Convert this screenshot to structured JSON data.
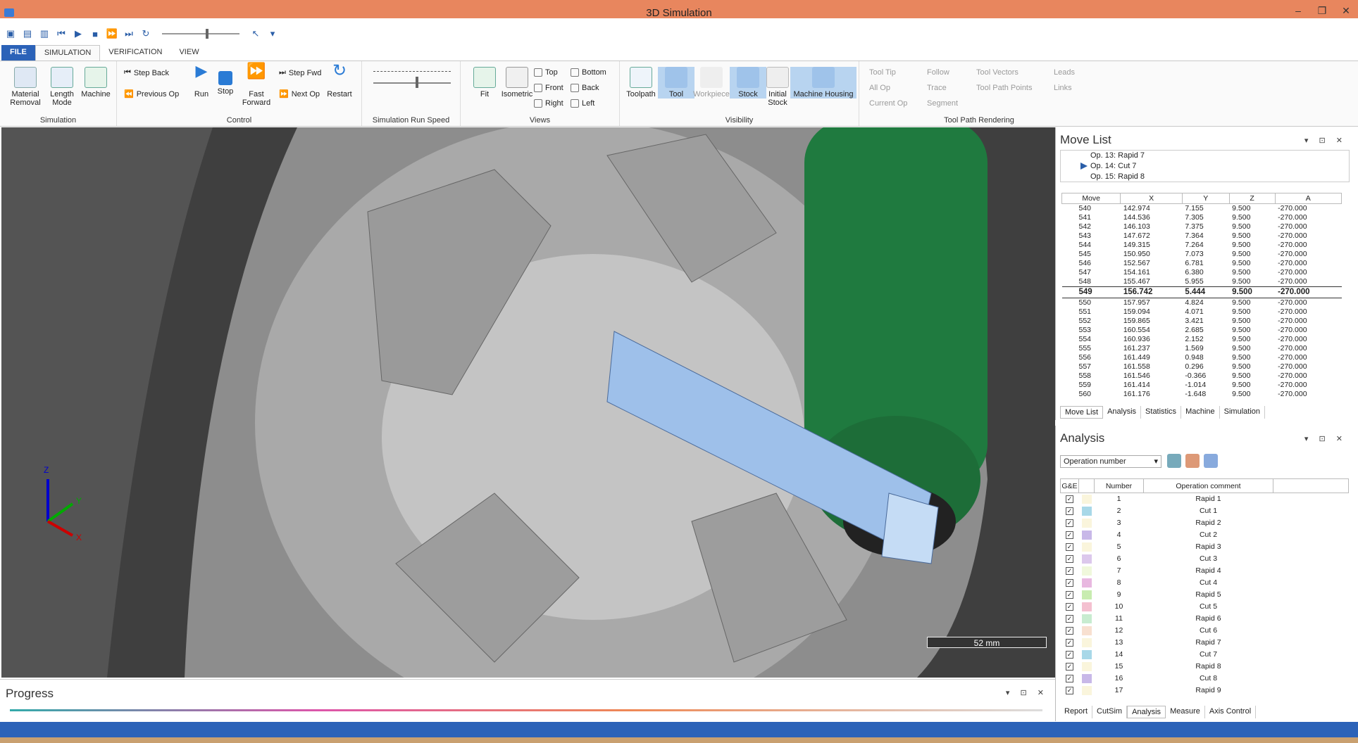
{
  "window": {
    "title": "3D Simulation"
  },
  "tabs": [
    "FILE",
    "SIMULATION",
    "VERIFICATION",
    "VIEW"
  ],
  "ribbon": {
    "simulation": {
      "label": "Simulation",
      "material_removal": "Material Removal",
      "length_mode": "Length Mode",
      "machine": "Machine"
    },
    "control": {
      "label": "Control",
      "step_back": "Step Back",
      "previous_op": "Previous Op",
      "run": "Run",
      "stop": "Stop",
      "fast_forward": "Fast Forward",
      "step_fwd": "Step Fwd",
      "next_op": "Next Op",
      "restart": "Restart"
    },
    "speed": {
      "label": "Simulation Run Speed"
    },
    "views": {
      "label": "Views",
      "fit": "Fit",
      "isometric": "Isometric",
      "top": "Top",
      "front": "Front",
      "right": "Right",
      "bottom": "Bottom",
      "back": "Back",
      "left": "Left"
    },
    "visibility": {
      "label": "Visibility",
      "toolpath": "Toolpath",
      "tool": "Tool",
      "workpiece": "Workpiece",
      "stock": "Stock",
      "initial_stock": "Initial Stock",
      "machine_housing": "Machine Housing"
    },
    "rendering": {
      "label": "Tool Path Rendering",
      "tool_tip": "Tool Tip",
      "all_op": "All Op",
      "current_op": "Current Op",
      "follow": "Follow",
      "trace": "Trace",
      "segment": "Segment",
      "tool_vectors": "Tool Vectors",
      "tool_path_points": "Tool Path Points",
      "leads": "Leads",
      "links": "Links"
    }
  },
  "viewport": {
    "scale_label": "52 mm",
    "axes": {
      "x": "X",
      "y": "Y",
      "z": "Z"
    }
  },
  "progress": {
    "title": "Progress"
  },
  "movelist": {
    "title": "Move List",
    "ops": [
      "Op. 13: Rapid 7",
      "Op. 14: Cut 7",
      "Op. 15: Rapid 8"
    ],
    "columns": [
      "Move",
      "X",
      "Y",
      "Z",
      "A"
    ],
    "rows": [
      [
        "540",
        "142.974",
        "7.155",
        "9.500",
        "-270.000"
      ],
      [
        "541",
        "144.536",
        "7.305",
        "9.500",
        "-270.000"
      ],
      [
        "542",
        "146.103",
        "7.375",
        "9.500",
        "-270.000"
      ],
      [
        "543",
        "147.672",
        "7.364",
        "9.500",
        "-270.000"
      ],
      [
        "544",
        "149.315",
        "7.264",
        "9.500",
        "-270.000"
      ],
      [
        "545",
        "150.950",
        "7.073",
        "9.500",
        "-270.000"
      ],
      [
        "546",
        "152.567",
        "6.781",
        "9.500",
        "-270.000"
      ],
      [
        "547",
        "154.161",
        "6.380",
        "9.500",
        "-270.000"
      ],
      [
        "548",
        "155.467",
        "5.955",
        "9.500",
        "-270.000"
      ],
      [
        "549",
        "156.742",
        "5.444",
        "9.500",
        "-270.000"
      ],
      [
        "550",
        "157.957",
        "4.824",
        "9.500",
        "-270.000"
      ],
      [
        "551",
        "159.094",
        "4.071",
        "9.500",
        "-270.000"
      ],
      [
        "552",
        "159.865",
        "3.421",
        "9.500",
        "-270.000"
      ],
      [
        "553",
        "160.554",
        "2.685",
        "9.500",
        "-270.000"
      ],
      [
        "554",
        "160.936",
        "2.152",
        "9.500",
        "-270.000"
      ],
      [
        "555",
        "161.237",
        "1.569",
        "9.500",
        "-270.000"
      ],
      [
        "556",
        "161.449",
        "0.948",
        "9.500",
        "-270.000"
      ],
      [
        "557",
        "161.558",
        "0.296",
        "9.500",
        "-270.000"
      ],
      [
        "558",
        "161.546",
        "-0.366",
        "9.500",
        "-270.000"
      ],
      [
        "559",
        "161.414",
        "-1.014",
        "9.500",
        "-270.000"
      ],
      [
        "560",
        "161.176",
        "-1.648",
        "9.500",
        "-270.000"
      ]
    ],
    "current_row": 9,
    "tabs": [
      "Move List",
      "Analysis",
      "Statistics",
      "Machine",
      "Simulation"
    ]
  },
  "analysis": {
    "title": "Analysis",
    "dropdown": "Operation number",
    "columns": [
      "G&E",
      "Number",
      "Operation comment"
    ],
    "rows": [
      {
        "n": "1",
        "c": "Rapid 1",
        "color": "#faf5dc"
      },
      {
        "n": "2",
        "c": "Cut 1",
        "color": "#a8d8e8"
      },
      {
        "n": "3",
        "c": "Rapid 2",
        "color": "#faf5dc"
      },
      {
        "n": "4",
        "c": "Cut 2",
        "color": "#c8b8e8"
      },
      {
        "n": "5",
        "c": "Rapid 3",
        "color": "#faf5dc"
      },
      {
        "n": "6",
        "c": "Cut 3",
        "color": "#dcc8ec"
      },
      {
        "n": "7",
        "c": "Rapid 4",
        "color": "#f0f8dc"
      },
      {
        "n": "8",
        "c": "Cut 4",
        "color": "#e8b8e0"
      },
      {
        "n": "9",
        "c": "Rapid 5",
        "color": "#c8ecb0"
      },
      {
        "n": "10",
        "c": "Cut 5",
        "color": "#f4c0d0"
      },
      {
        "n": "11",
        "c": "Rapid 6",
        "color": "#c8ecd0"
      },
      {
        "n": "12",
        "c": "Cut 6",
        "color": "#f8e0d0"
      },
      {
        "n": "13",
        "c": "Rapid 7",
        "color": "#faf5dc"
      },
      {
        "n": "14",
        "c": "Cut 7",
        "color": "#a8d8e8"
      },
      {
        "n": "15",
        "c": "Rapid 8",
        "color": "#faf5dc"
      },
      {
        "n": "16",
        "c": "Cut 8",
        "color": "#c8b8e8"
      },
      {
        "n": "17",
        "c": "Rapid 9",
        "color": "#faf5dc"
      }
    ],
    "tabs": [
      "Report",
      "CutSim",
      "Analysis",
      "Measure",
      "Axis Control"
    ]
  }
}
